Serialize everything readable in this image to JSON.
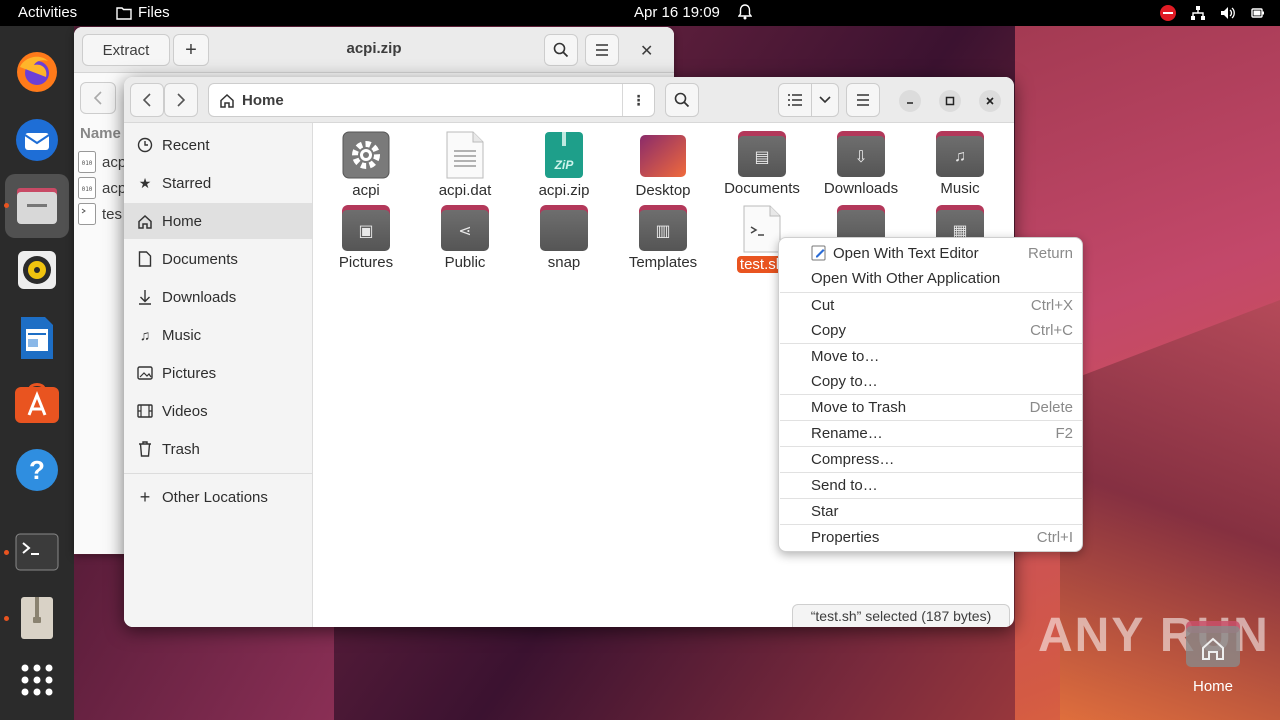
{
  "topbar": {
    "activities": "Activities",
    "app_name": "Files",
    "clock": "Apr 16  19:09"
  },
  "archive_window": {
    "extract_label": "Extract",
    "add_label": "+",
    "title": "acpi.zip",
    "column_header": "Name",
    "rows": [
      "acp",
      "acp",
      "tes"
    ]
  },
  "files_window": {
    "path": "Home",
    "sidebar": {
      "items": [
        "Recent",
        "Starred",
        "Home",
        "Documents",
        "Downloads",
        "Music",
        "Pictures",
        "Videos",
        "Trash"
      ],
      "other_locations": "Other Locations"
    },
    "grid_items": [
      "acpi",
      "acpi.dat",
      "acpi.zip",
      "Desktop",
      "Documents",
      "Downloads",
      "Music",
      "Pictures",
      "Public",
      "snap",
      "Templates",
      "test.sh"
    ],
    "status": "“test.sh” selected  (187 bytes)"
  },
  "context_menu": {
    "items": [
      {
        "label": "Open With Text Editor",
        "accel": "Return"
      },
      {
        "label": "Open With Other Application",
        "accel": ""
      },
      {
        "label": "Cut",
        "accel": "Ctrl+X"
      },
      {
        "label": "Copy",
        "accel": "Ctrl+C"
      },
      {
        "label": "Move to…",
        "accel": ""
      },
      {
        "label": "Copy to…",
        "accel": ""
      },
      {
        "label": "Move to Trash",
        "accel": "Delete"
      },
      {
        "label": "Rename…",
        "accel": "F2"
      },
      {
        "label": "Compress…",
        "accel": ""
      },
      {
        "label": "Send to…",
        "accel": ""
      },
      {
        "label": "Star",
        "accel": ""
      },
      {
        "label": "Properties",
        "accel": "Ctrl+I"
      }
    ]
  },
  "desktop": {
    "home_label": "Home",
    "watermark": "ANY RUN"
  },
  "colors": {
    "accent": "#e95420",
    "folder_tab": "#b3385a"
  }
}
